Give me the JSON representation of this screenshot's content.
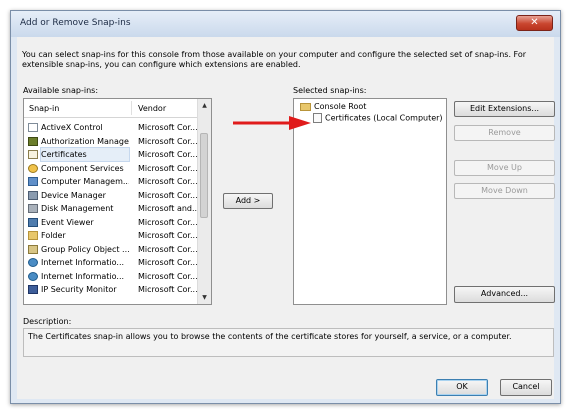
{
  "window": {
    "title": "Add or Remove Snap-ins",
    "close_glyph": "✕"
  },
  "intro_text": "You can select snap-ins for this console from those available on your computer and configure the selected set of snap-ins. For extensible snap-ins, you can configure which extensions are enabled.",
  "available": {
    "label": "Available snap-ins:",
    "columns": {
      "name": "Snap-in",
      "vendor": "Vendor"
    },
    "rows": [
      {
        "name": "ActiveX Control",
        "vendor": "Microsoft Cor...",
        "icon": "activex-icon"
      },
      {
        "name": "Authorization Manager",
        "vendor": "Microsoft Cor...",
        "icon": "authorization-icon"
      },
      {
        "name": "Certificates",
        "vendor": "Microsoft Cor...",
        "icon": "certificate-icon",
        "selected": true
      },
      {
        "name": "Component Services",
        "vendor": "Microsoft Cor...",
        "icon": "component-icon"
      },
      {
        "name": "Computer Managem...",
        "vendor": "Microsoft Cor...",
        "icon": "computer-management-icon"
      },
      {
        "name": "Device Manager",
        "vendor": "Microsoft Cor...",
        "icon": "device-manager-icon"
      },
      {
        "name": "Disk Management",
        "vendor": "Microsoft and...",
        "icon": "disk-icon"
      },
      {
        "name": "Event Viewer",
        "vendor": "Microsoft Cor...",
        "icon": "event-viewer-icon"
      },
      {
        "name": "Folder",
        "vendor": "Microsoft Cor...",
        "icon": "folder-icon"
      },
      {
        "name": "Group Policy Object ...",
        "vendor": "Microsoft Cor...",
        "icon": "group-policy-icon"
      },
      {
        "name": "Internet Informatio...",
        "vendor": "Microsoft Cor...",
        "icon": "iis-icon"
      },
      {
        "name": "Internet Informatio...",
        "vendor": "Microsoft Cor...",
        "icon": "iis-icon"
      },
      {
        "name": "IP Security Monitor",
        "vendor": "Microsoft Cor...",
        "icon": "ip-security-icon"
      }
    ]
  },
  "add_button": "Add >",
  "selected": {
    "label": "Selected snap-ins:",
    "root": "Console Root",
    "child": "Certificates (Local Computer)"
  },
  "buttons": {
    "edit_extensions": "Edit Extensions...",
    "remove": "Remove",
    "move_up": "Move Up",
    "move_down": "Move Down",
    "advanced": "Advanced...",
    "ok": "OK",
    "cancel": "Cancel"
  },
  "description": {
    "label": "Description:",
    "text": "The Certificates snap-in allows you to browse the contents of the certificate stores for yourself, a service, or a computer."
  },
  "colors": {
    "arrow": "#e01b1b",
    "selection": "#e5eef8"
  }
}
